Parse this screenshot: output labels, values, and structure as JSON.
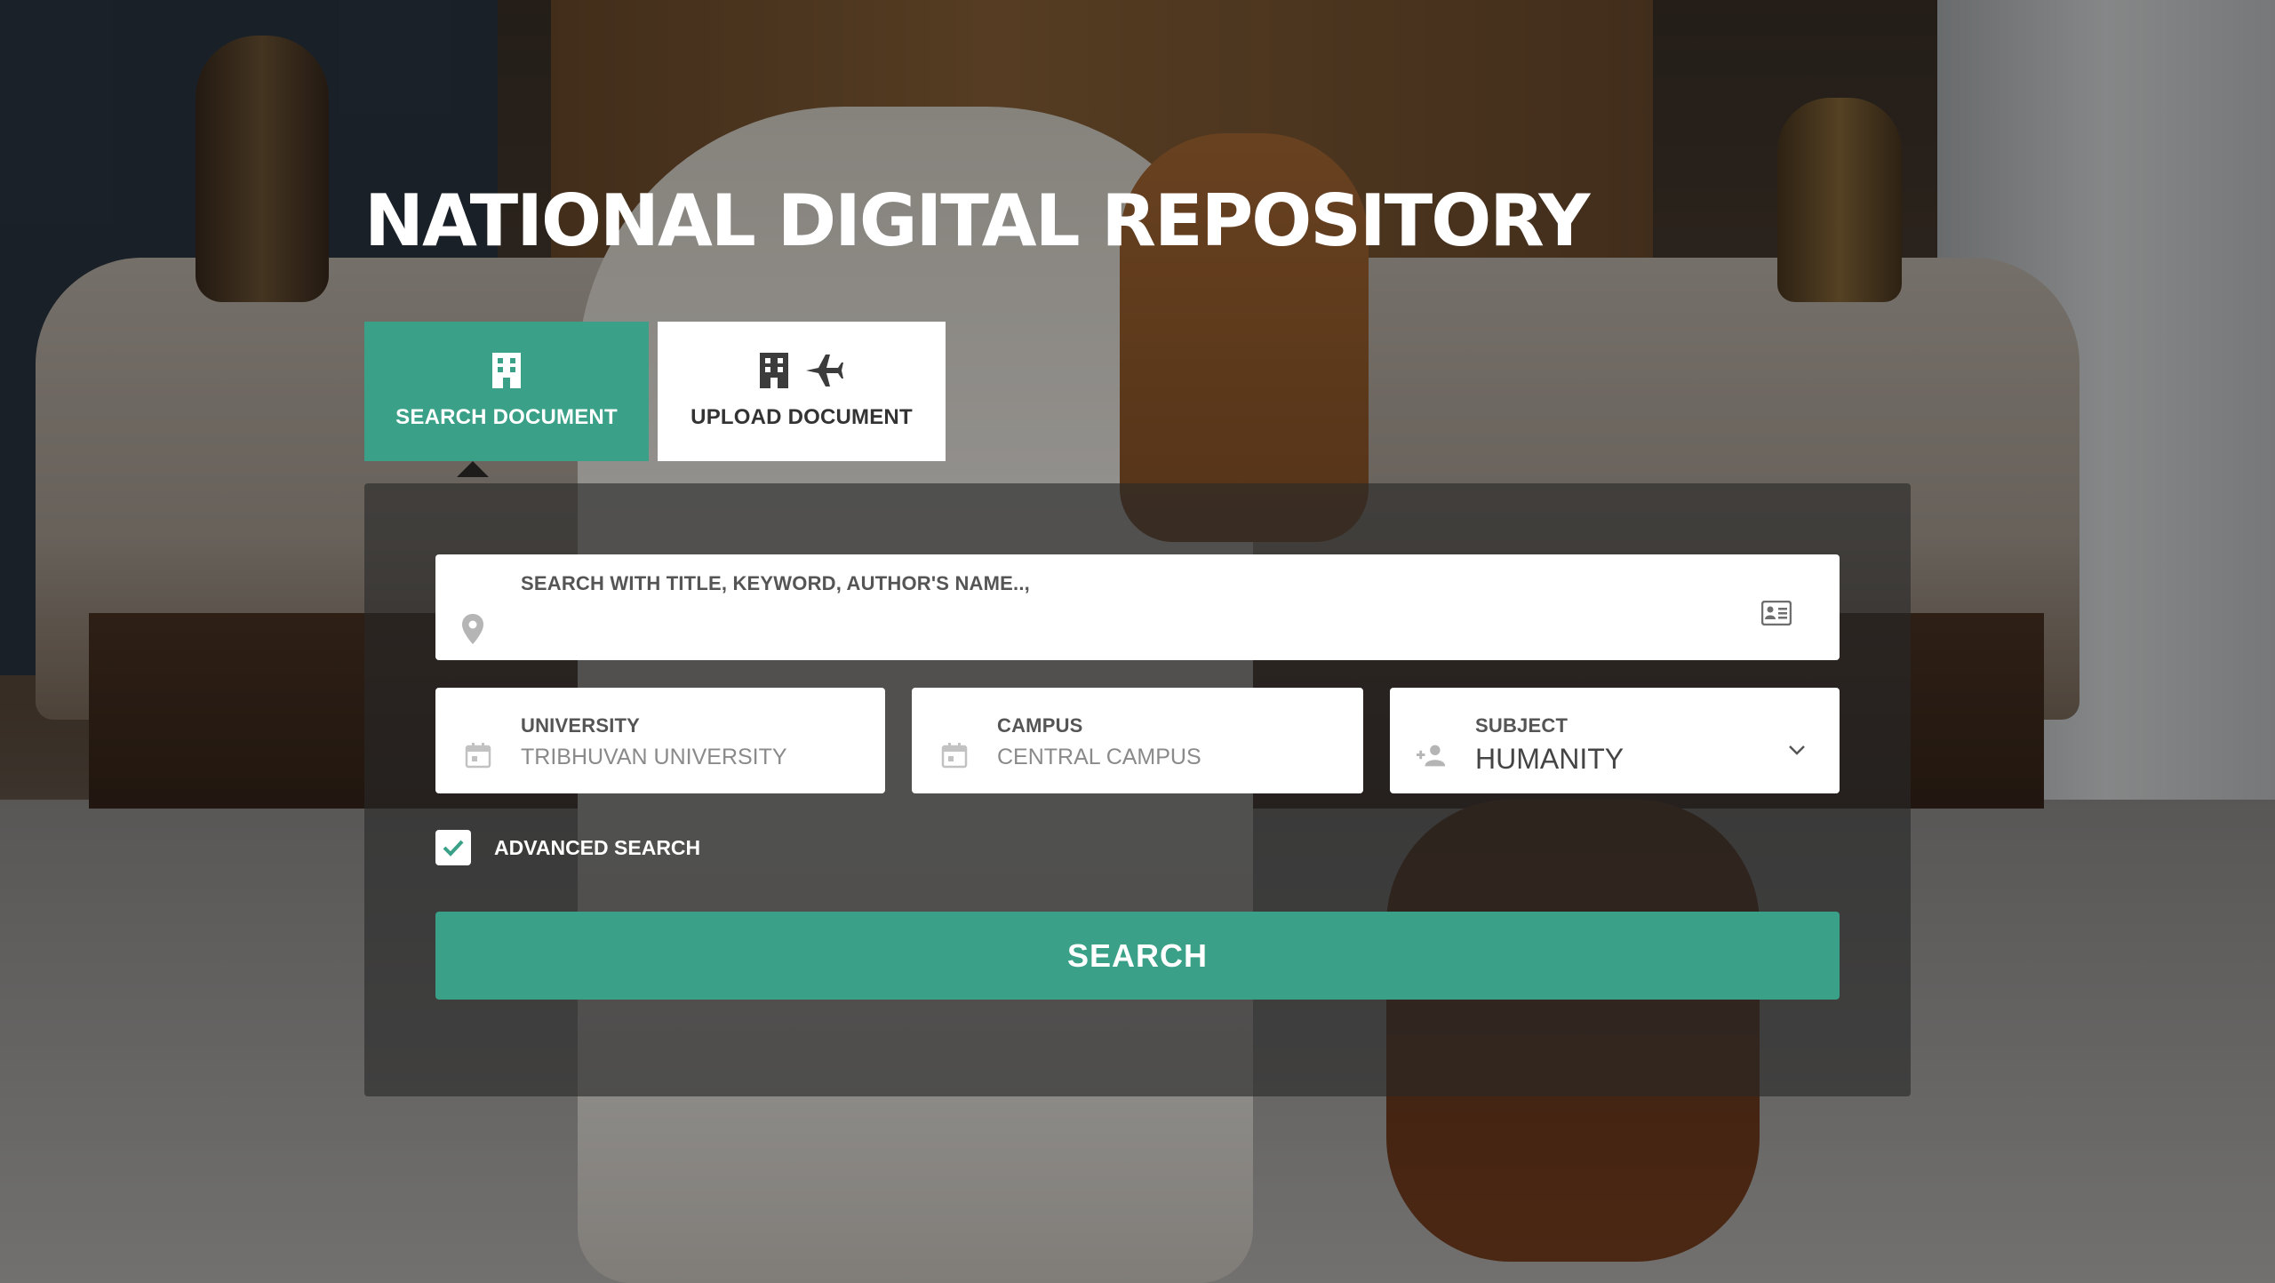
{
  "page": {
    "title": "NATIONAL DIGITAL REPOSITORY"
  },
  "tabs": [
    {
      "label": "SEARCH DOCUMENT",
      "icons": [
        "building-icon"
      ],
      "active": true
    },
    {
      "label": "UPLOAD DOCUMENT",
      "icons": [
        "building-icon",
        "airplane-icon"
      ],
      "active": false
    }
  ],
  "search": {
    "label": "SEARCH WITH TITLE, KEYWORD, AUTHOR'S NAME..,",
    "value": "",
    "placeholder": "",
    "left_icon": "location-pin-icon",
    "right_icon": "id-card-icon"
  },
  "filters": {
    "university": {
      "label": "UNIVERSITY",
      "value": "TRIBHUVAN UNIVERSITY",
      "icon": "calendar-icon"
    },
    "campus": {
      "label": "CAMPUS",
      "value": "CENTRAL CAMPUS",
      "icon": "calendar-icon"
    },
    "subject": {
      "label": "SUBJECT",
      "value": "HUMANITY",
      "icon": "add-person-icon",
      "dropdown_icon": "chevron-down-icon"
    }
  },
  "advanced_search": {
    "label": "ADVANCED SEARCH",
    "checked": true
  },
  "search_button": {
    "label": "SEARCH"
  },
  "colors": {
    "accent": "#3aa087",
    "panel": "rgba(40,40,40,0.62)",
    "title_text": "#ffffff"
  }
}
